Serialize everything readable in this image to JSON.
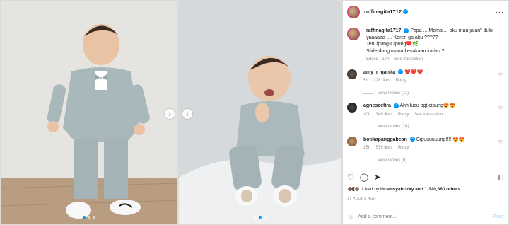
{
  "post": {
    "username": "raffinagita1717",
    "caption_user": "raffinagita1717",
    "caption": "Papa ... Mama ... aku mau jalan\" dulu yaaaaaa .... Keren ga aku ?????",
    "caption_line2": "TerCipung-Cipung❤️🌿",
    "caption_line3": "Slide dong mana kesukaan kalian ?",
    "caption_meta": {
      "edited": "Edited · 17h",
      "translation": "See translation"
    }
  },
  "comments": [
    {
      "user": "amy_r_qanita",
      "text": "❤️❤️❤️",
      "time": "5h",
      "likes": "228 likes",
      "reply": "Reply",
      "replies": "View replies (11)"
    },
    {
      "user": "agnescefira",
      "text": "Ahh lucu bgt cipung😍😍",
      "time": "10h",
      "likes": "749 likes",
      "reply": "Reply",
      "translation": "See translation",
      "replies": "View replies (24)"
    },
    {
      "user": "botikapanggabean",
      "text": "Cipuuuuuung!!!! 😍😍",
      "time": "15h",
      "likes": "579 likes",
      "reply": "Reply",
      "replies": "View replies (6)"
    }
  ],
  "likes": {
    "prefix": "Liked by",
    "user": "ihramsyahrizky",
    "suffix": "and 1,320,380 others"
  },
  "post_time": "17 HOURS AGO",
  "comment_box": {
    "placeholder": "Add a comment...",
    "post_label": "Post"
  },
  "icons": {
    "heart": "heart-icon",
    "comment": "comment-icon",
    "share": "share-icon",
    "save": "bookmark-icon"
  },
  "colors": {
    "verified": "#0095f6",
    "link": "#0095f6"
  }
}
